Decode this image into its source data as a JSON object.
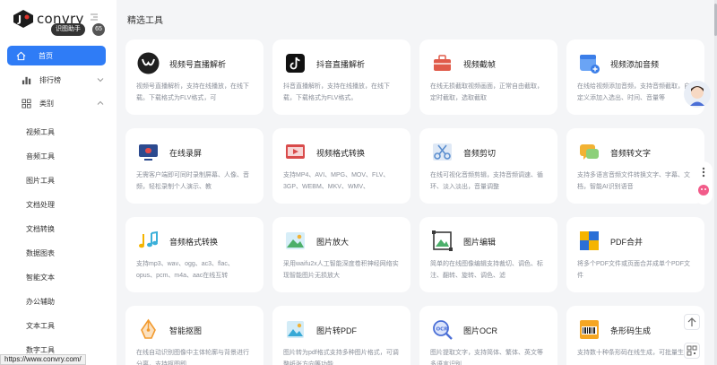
{
  "brand": {
    "name": "convry"
  },
  "tags": {
    "reader": "识图助手",
    "circle": "65"
  },
  "sidebar": {
    "home": "首页",
    "ranking": "排行榜",
    "category": "类别",
    "sub_items": [
      "视频工具",
      "音频工具",
      "图片工具",
      "文档处理",
      "文档转换",
      "数据图表",
      "智能文本",
      "办公辅助",
      "文本工具",
      "数字工具"
    ]
  },
  "main": {
    "title": "精选工具",
    "cards": [
      {
        "title": "视频号直播解析",
        "desc": "视频号直播解析，支持在线播放，在线下载。下载格式为FLV格式，可",
        "icon": "wechat-channels-icon",
        "color": "#1f1f1f"
      },
      {
        "title": "抖音直播解析",
        "desc": "抖音直播解析，支持在线播放，在线下载，下载格式为FLV格式。",
        "icon": "tiktok-icon",
        "color": "#111111"
      },
      {
        "title": "视频截帧",
        "desc": "在线无损截取视频画面，正常自由截取，定时截取，选取截取",
        "icon": "toolbox-icon",
        "color": "#e05b4a"
      },
      {
        "title": "视频添加音频",
        "desc": "在线给视频添加音频，支持音频截取，自定义添加入选出、时间、音量等",
        "icon": "calendar-add-icon",
        "color": "#4a8ef0"
      },
      {
        "title": "在线录屏",
        "desc": "无需客户端即可同时录制屏幕、人像、音频，轻松录制个人演示、教",
        "icon": "screen-record-icon",
        "color": "#2c4a8f"
      },
      {
        "title": "视频格式转换",
        "desc": "支持MP4、AVI、MPG、MOV、FLV、3GP、WEBM、MKV、WMV、",
        "icon": "video-player-icon",
        "color": "#d94b4b"
      },
      {
        "title": "音频剪切",
        "desc": "在线可视化音频剪辑，支持音频调速、循环、淡入淡出，音量调整",
        "icon": "scissors-icon",
        "color": "#5c8fcf"
      },
      {
        "title": "音频转文字",
        "desc": "支持多语言音频文件转换文字、字幕、文档，智能AI识别语音",
        "icon": "chat-bubble-icon",
        "color": "#f2b233"
      },
      {
        "title": "音频格式转换",
        "desc": "支持mp3、wav、ogg、ac3、flac、opus、pcm、m4a、aac在线互转",
        "icon": "music-note-icon",
        "color": "#f5b400"
      },
      {
        "title": "图片放大",
        "desc": "采用waifu2x人工智能深度卷积神经网络实现智能图片无损放大",
        "icon": "image-zoom-icon",
        "color": "#3bb0d9"
      },
      {
        "title": "图片编辑",
        "desc": "简单的在线图像编辑支持裁切、调色、标注、翻转、旋转、调色、滤",
        "icon": "image-edit-icon",
        "color": "#3a3a3a"
      },
      {
        "title": "PDF合并",
        "desc": "将多个PDF文件或页面合并成单个PDF文件",
        "icon": "pdf-merge-icon",
        "color": "#2b6fd6"
      },
      {
        "title": "智能抠图",
        "desc": "在线自动识别图像中主体轮廓与背景进行分离，支持抠图即",
        "icon": "pen-tool-icon",
        "color": "#f29a2e"
      },
      {
        "title": "图片转PDF",
        "desc": "图片转为pdf格式支持多种图片格式，可调整纸张方向等功能",
        "icon": "image-pdf-icon",
        "color": "#38a9d6"
      },
      {
        "title": "图片OCR",
        "desc": "图片提取文字，支持简体、繁体、英文等多语言识别",
        "icon": "ocr-icon",
        "color": "#4b6fd6"
      },
      {
        "title": "条形码生成",
        "desc": "支持数十种条形码在线生成，可批量生成",
        "icon": "barcode-icon",
        "color": "#f5a623"
      }
    ]
  },
  "status_url": "https://www.convry.com/",
  "colors": {
    "accent": "#2f7cf6",
    "background": "#f4f5f7"
  }
}
